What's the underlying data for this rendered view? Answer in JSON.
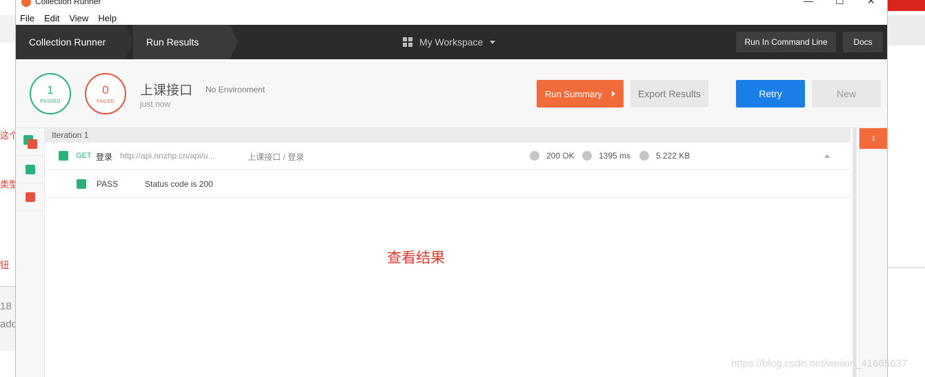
{
  "background": {
    "left_texts": [
      "这个",
      "类型",
      "钮"
    ],
    "left_gray": [
      "18",
      "ado"
    ],
    "watermark": "https://blog.csdn.net/weixin_41665637",
    "accent_red": "#d9251d"
  },
  "window": {
    "title": "Collection Runner",
    "controls": [
      "—",
      "☐",
      "✕"
    ]
  },
  "menu": [
    "File",
    "Edit",
    "View",
    "Help"
  ],
  "topbar": {
    "crumb_runner": "Collection Runner",
    "crumb_results": "Run Results",
    "workspace": "My Workspace",
    "run_cmd_label": "Run In Command Line",
    "docs_label": "Docs"
  },
  "summary": {
    "passed_count": "1",
    "passed_label": "PASSED",
    "failed_count": "0",
    "failed_label": "FAILED",
    "collection_name": "上课接口",
    "environment": "No Environment",
    "time": "just now",
    "run_summary_label": "Run Summary",
    "export_label": "Export Results",
    "retry_label": "Retry",
    "new_label": "New"
  },
  "iteration": {
    "header": "Iteration 1",
    "badge": "1",
    "request": {
      "method": "GET",
      "name": "登录",
      "url": "http://api.nnzhp.cn/api/u...",
      "path": "上课接口 / 登录",
      "status": "200 OK",
      "time": "1395 ms",
      "size": "5.222 KB"
    },
    "test": {
      "result": "PASS",
      "name": "Status code is 200"
    }
  },
  "annotation": "查看结果",
  "colors": {
    "pass": "#2ab27b",
    "fail": "#e5533d",
    "orange": "#f26b3a",
    "blue": "#1a7fe8"
  }
}
